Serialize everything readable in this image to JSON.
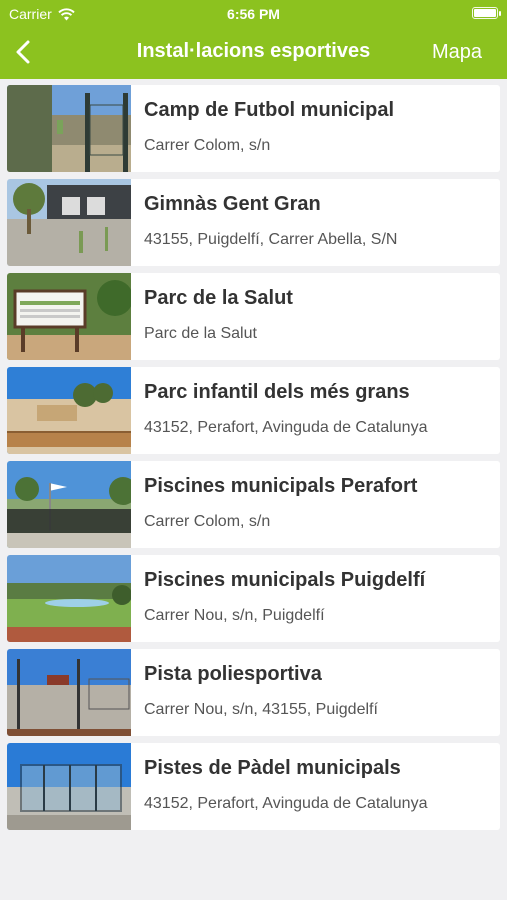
{
  "status_bar": {
    "carrier": "Carrier",
    "time": "6:56 PM",
    "wifi_icon": "wifi-icon",
    "battery_icon": "battery-icon"
  },
  "nav": {
    "back_icon": "chevron-left-icon",
    "title": "Instal·lacions esportives",
    "right_action": "Mapa",
    "bar_color": "#8cc21f"
  },
  "facilities": [
    {
      "name": "Camp de Futbol municipal",
      "address": "Carrer Colom, s/n",
      "photo": "football-field-photo"
    },
    {
      "name": "Gimnàs Gent Gran",
      "address": "43155, Puigdelfí, Carrer Abella, S/N",
      "photo": "outdoor-gym-photo"
    },
    {
      "name": "Parc de la Salut",
      "address": "Parc de la Salut",
      "photo": "health-circuit-sign-photo"
    },
    {
      "name": "Parc infantil dels més grans",
      "address": "43152, Perafort, Avinguda de Catalunya",
      "photo": "playground-photo"
    },
    {
      "name": "Piscines municipals Perafort",
      "address": "Carrer Colom, s/n",
      "photo": "pool-perafort-photo"
    },
    {
      "name": "Piscines municipals Puigdelfí",
      "address": "Carrer Nou, s/n, Puigdelfí",
      "photo": "pool-puigdelfi-photo"
    },
    {
      "name": "Pista poliesportiva",
      "address": "Carrer Nou, s/n, 43155, Puigdelfí",
      "photo": "sports-court-photo"
    },
    {
      "name": "Pistes de Pàdel municipals",
      "address": "43152, Perafort, Avinguda de Catalunya",
      "photo": "padel-court-photo"
    }
  ]
}
